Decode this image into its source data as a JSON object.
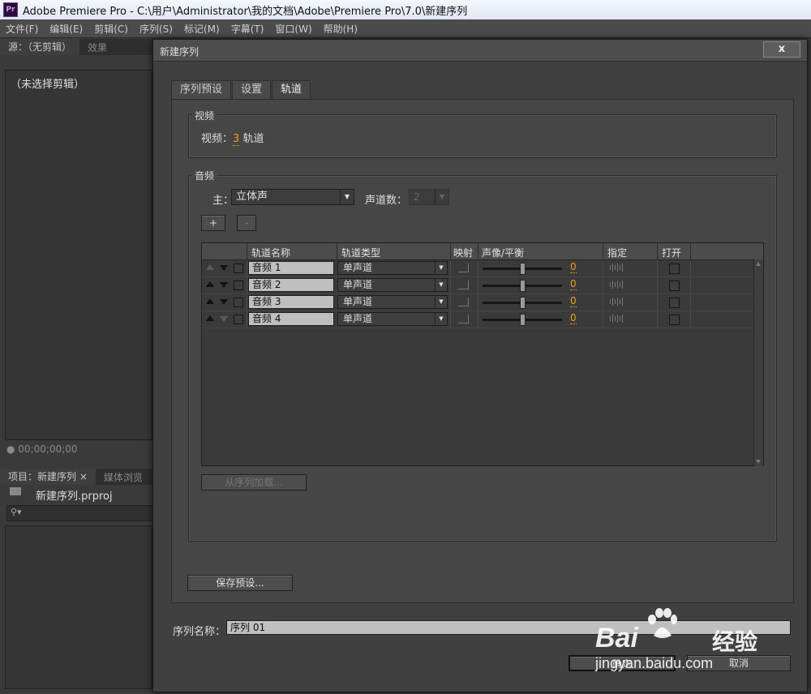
{
  "window": {
    "title": "Adobe Premiere Pro - C:\\用户\\Administrator\\我的文档\\Adobe\\Premiere Pro\\7.0\\新建序列",
    "logo": "Pr"
  },
  "menu": [
    "文件(F)",
    "编辑(E)",
    "剪辑(C)",
    "序列(S)",
    "标记(M)",
    "字幕(T)",
    "窗口(W)",
    "帮助(H)"
  ],
  "source_panel": {
    "tabs": [
      "源：（无剪辑）",
      "效果"
    ],
    "empty_text": "（未选择剪辑）",
    "timecode": "00;00;00;00"
  },
  "project_panel": {
    "tabs": [
      "项目：新建序列 ×",
      "媒体浏览"
    ],
    "file": "新建序列.prproj",
    "search_icon": "magnifier-icon"
  },
  "dialog": {
    "title": "新建序列",
    "close_label": "x",
    "tabs": [
      "序列预设",
      "设置",
      "轨道"
    ],
    "active_tab": 2,
    "video": {
      "group_label": "视频",
      "label": "视频：",
      "count": "3",
      "unit": "轨道"
    },
    "audio": {
      "group_label": "音频",
      "master_label": "主：",
      "master_value": "立体声",
      "channels_label": "声道数：",
      "channels_value": "2",
      "add_label": "+",
      "remove_label": "-",
      "columns": [
        "轨道名称",
        "轨道类型",
        "映射",
        "声像/平衡",
        "指定",
        "打开"
      ],
      "tracks": [
        {
          "name": "音频 1",
          "type": "单声道",
          "pan": "0"
        },
        {
          "name": "音频 2",
          "type": "单声道",
          "pan": "0"
        },
        {
          "name": "音频 3",
          "type": "单声道",
          "pan": "0"
        },
        {
          "name": "音频 4",
          "type": "单声道",
          "pan": "0"
        }
      ],
      "load_label": "从序列加载..."
    },
    "save_preset_label": "保存预设...",
    "seq_name_label": "序列名称：",
    "seq_name_value": "序列 01",
    "ok_label": "确定",
    "cancel_label": "取消"
  },
  "watermark": {
    "brand": "Bai",
    "brand2": "经验",
    "url": "jingyan.baidu.com"
  },
  "colors": {
    "accent_orange": "#e8a21c",
    "dialog_bg": "#464646"
  }
}
